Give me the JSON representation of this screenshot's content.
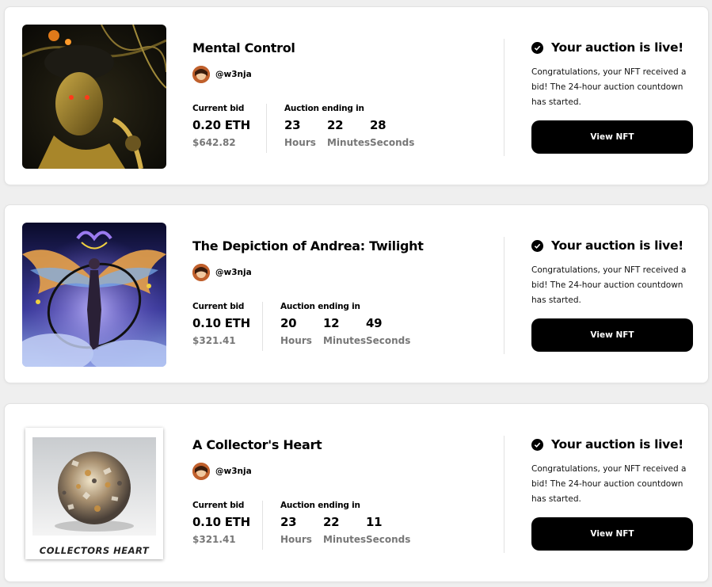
{
  "cards": [
    {
      "title": "Mental Control",
      "creator": "@w3nja",
      "bid_label": "Current bid",
      "bid_eth": "0.20 ETH",
      "bid_usd": "$642.82",
      "auction_label": "Auction ending in",
      "hours": "23",
      "hours_label": "Hours",
      "minutes": "22",
      "minutes_label": "Minutes",
      "seconds": "28",
      "seconds_label": "Seconds",
      "status": "Your auction is live!",
      "message": "Congratulations, your NFT received a bid! The 24-hour auction countdown has started.",
      "button": "View NFT"
    },
    {
      "title": "The Depiction of Andrea: Twilight",
      "creator": "@w3nja",
      "bid_label": "Current bid",
      "bid_eth": "0.10 ETH",
      "bid_usd": "$321.41",
      "auction_label": "Auction ending in",
      "hours": "20",
      "hours_label": "Hours",
      "minutes": "12",
      "minutes_label": "Minutes",
      "seconds": "49",
      "seconds_label": "Seconds",
      "status": "Your auction is live!",
      "message": "Congratulations, your NFT received a bid! The 24-hour auction countdown has started.",
      "button": "View NFT"
    },
    {
      "title": "A Collector's Heart",
      "creator": "@w3nja",
      "artwork_caption": "COLLECTORS HEART",
      "bid_label": "Current bid",
      "bid_eth": "0.10 ETH",
      "bid_usd": "$321.41",
      "auction_label": "Auction ending in",
      "hours": "23",
      "hours_label": "Hours",
      "minutes": "22",
      "minutes_label": "Minutes",
      "seconds": "11",
      "seconds_label": "Seconds",
      "status": "Your auction is live!",
      "message": "Congratulations, your NFT received a bid! The 24-hour auction countdown has started.",
      "button": "View NFT"
    }
  ],
  "colors": {
    "button_bg": "#000000",
    "muted_text": "#777777",
    "page_bg": "#efefef"
  }
}
